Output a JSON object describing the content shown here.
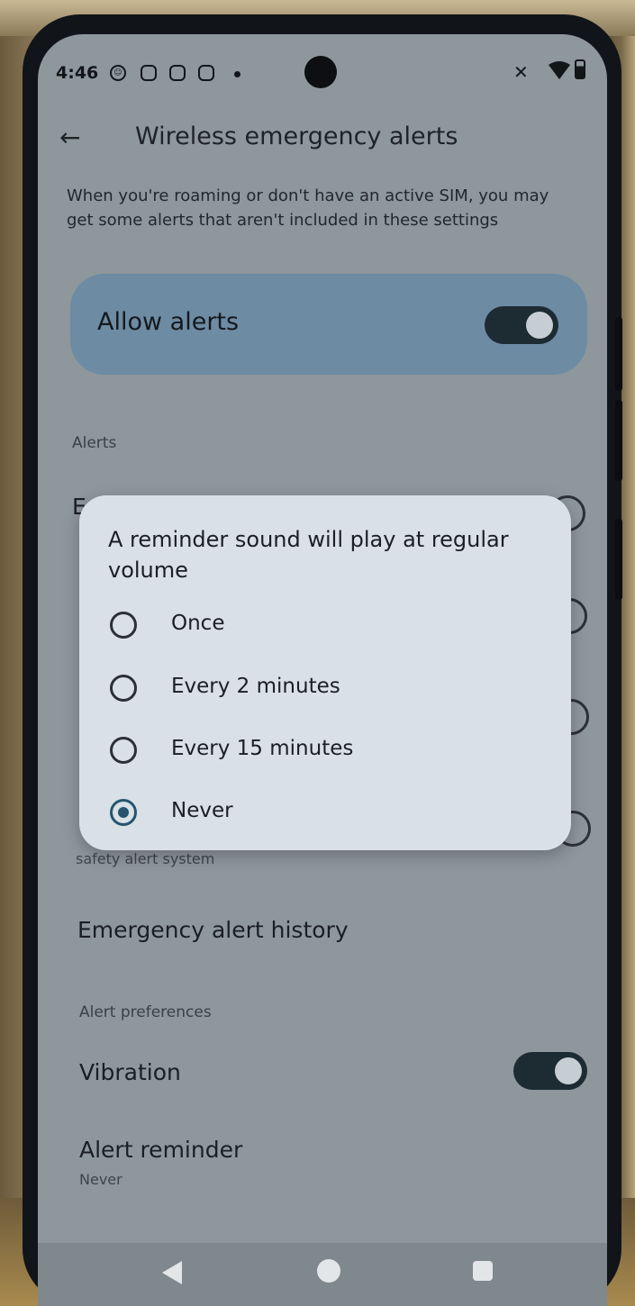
{
  "status_bar": {
    "time": "4:46",
    "icons": [
      "face-icon",
      "sim-icon",
      "clipboard-icon",
      "message-icon",
      "notification-dot-icon",
      "camera-cutout",
      "mute-vibrate-icon",
      "wifi-icon",
      "battery-icon"
    ]
  },
  "header": {
    "back_icon": "←",
    "title": "Wireless emergency alerts"
  },
  "info_text": "When you're roaming or don't have an active SIM, you may get some alerts that aren't included in these settings",
  "allow_alerts": {
    "label": "Allow alerts",
    "enabled": true
  },
  "alerts_section": {
    "header": "Alerts",
    "partial_first_char": "E",
    "partial_subtext": "safety alert system"
  },
  "history": {
    "label": "Emergency alert history"
  },
  "preferences_section": {
    "header": "Alert preferences",
    "vibration_label": "Vibration",
    "vibration_enabled": true,
    "reminder_label": "Alert reminder",
    "reminder_value": "Never"
  },
  "dialog": {
    "title": "A reminder sound will play at regular volume",
    "options": [
      {
        "label": "Once",
        "selected": false
      },
      {
        "label": "Every 2 minutes",
        "selected": false
      },
      {
        "label": "Every 15 minutes",
        "selected": false
      },
      {
        "label": "Never",
        "selected": true
      }
    ]
  },
  "nav_bar": {
    "icons": [
      "back-triangle-icon",
      "home-circle-icon",
      "recents-square-icon"
    ]
  },
  "colors": {
    "scrim_background": "#8e979c",
    "dialog_background": "#d9e1e6",
    "allow_card": "#6d8ba3",
    "toggle_on": "#1d2b33",
    "radio_selected": "#26546f"
  }
}
